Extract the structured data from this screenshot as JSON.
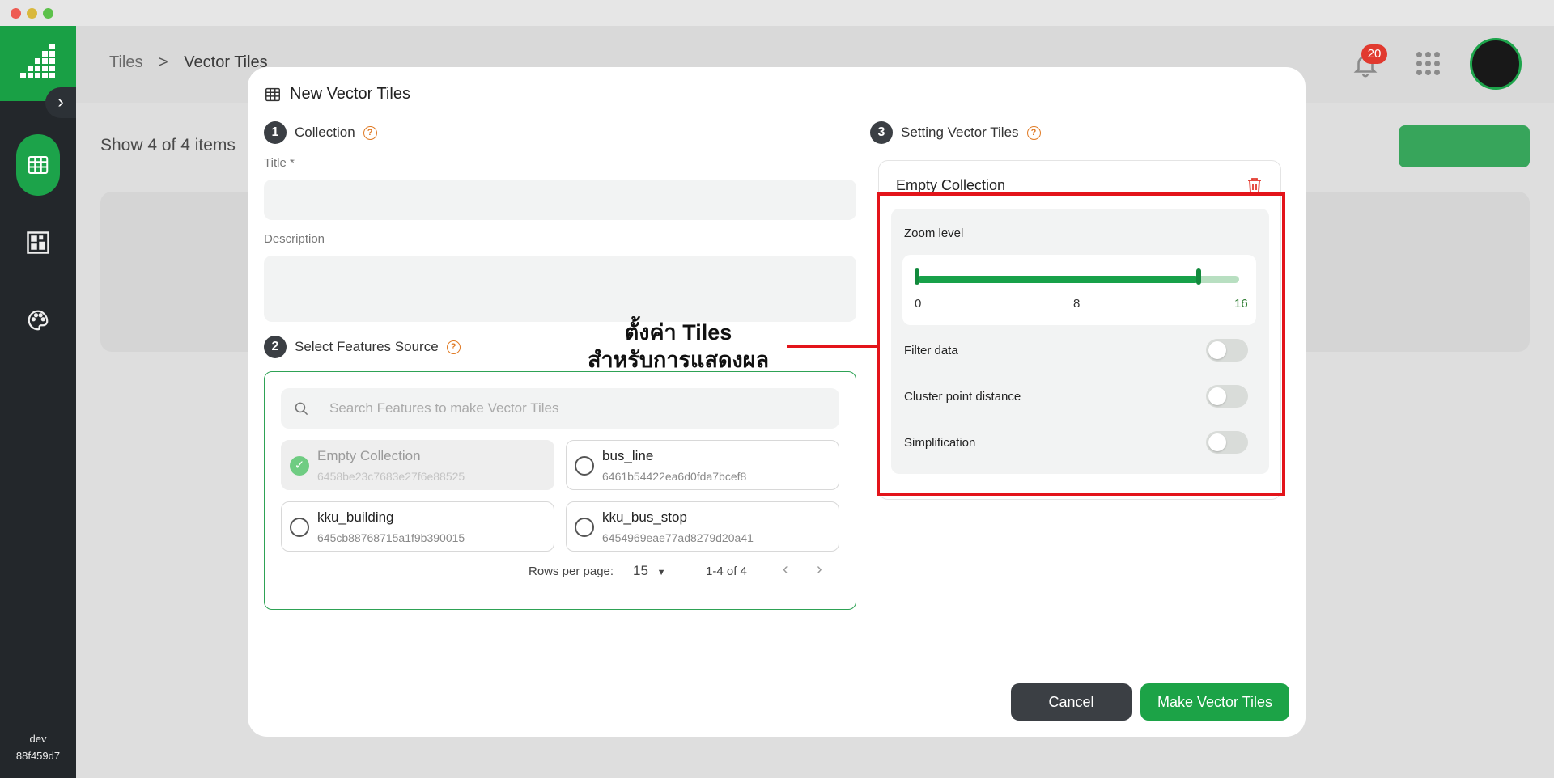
{
  "header": {
    "breadcrumb": [
      "Tiles",
      "Vector Tiles"
    ],
    "breadcrumb_separator": ">",
    "notification_count": "20"
  },
  "sidebar": {
    "footer_env": "dev",
    "footer_hash": "88f459d7"
  },
  "page": {
    "show_items": "Show 4 of 4 items"
  },
  "modal": {
    "title": "New Vector Tiles",
    "step1": {
      "num": "1",
      "label": "Collection"
    },
    "title_label": "Title *",
    "title_value": "",
    "description_label": "Description",
    "description_value": "",
    "step2": {
      "num": "2",
      "label": "Select Features Source"
    },
    "search_placeholder": "Search Features to make Vector Tiles",
    "features": [
      {
        "name": "Empty Collection",
        "id": "6458be23c7683e27f6e88525",
        "selected": true
      },
      {
        "name": "bus_line",
        "id": "6461b54422ea6d0fda7bcef8",
        "selected": false
      },
      {
        "name": "kku_building",
        "id": "645cb88768715a1f9b390015",
        "selected": false
      },
      {
        "name": "kku_bus_stop",
        "id": "6454969eae77ad8279d20a41",
        "selected": false
      }
    ],
    "pagination": {
      "rows_label": "Rows per page:",
      "rows_value": "15",
      "range": "1-4 of 4"
    },
    "step3": {
      "num": "3",
      "label": "Setting Vector Tiles"
    },
    "settings": {
      "collection_name": "Empty Collection",
      "zoom_label": "Zoom level",
      "zoom_min": "0",
      "zoom_mid": "8",
      "zoom_max": "16",
      "zoom_range_selected": [
        0,
        14
      ],
      "filter_label": "Filter data",
      "filter_on": false,
      "cluster_label": "Cluster point distance",
      "cluster_on": false,
      "simplification_label": "Simplification",
      "simplification_on": false
    },
    "cancel_label": "Cancel",
    "make_label": "Make Vector Tiles"
  },
  "annotation": {
    "line1": "ตั้งค่า Tiles",
    "line2": "สำหรับการแสดงผล",
    "color": "#e3141a"
  },
  "colors": {
    "brand_green": "#1ca347",
    "sidebar_dark": "#23272b",
    "help_orange": "#e07a24"
  }
}
